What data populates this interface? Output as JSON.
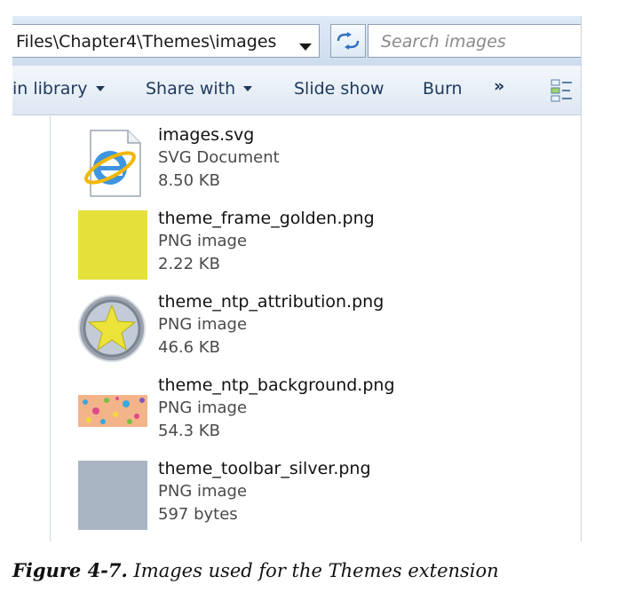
{
  "address": {
    "path": "Files\\Chapter4\\Themes\\images",
    "dropdown_icon": "chevron-down-icon",
    "refresh_icon": "refresh-arrows-icon"
  },
  "search": {
    "placeholder": "Search images",
    "icon": "search-icon"
  },
  "toolbar": {
    "include_label": "in library",
    "share_label": "Share with",
    "slideshow_label": "Slide show",
    "burn_label": "Burn",
    "overflow_label": "»",
    "views_icon": "change-view-icon"
  },
  "files": [
    {
      "name": "images.svg",
      "type": "SVG Document",
      "size": "8.50 KB",
      "icon": "ie-document-icon"
    },
    {
      "name": "theme_frame_golden.png",
      "type": "PNG image",
      "size": "2.22 KB",
      "icon": "yellow-thumbnail"
    },
    {
      "name": "theme_ntp_attribution.png",
      "type": "PNG image",
      "size": "46.6 KB",
      "icon": "star-badge-thumbnail"
    },
    {
      "name": "theme_ntp_background.png",
      "type": "PNG image",
      "size": "54.3 KB",
      "icon": "polka-dot-thumbnail"
    },
    {
      "name": "theme_toolbar_silver.png",
      "type": "PNG image",
      "size": "597 bytes",
      "icon": "silver-thumbnail"
    }
  ],
  "colors": {
    "toolbar_text": "#1e395b",
    "golden": "#e6e13a",
    "silver": "#a9b5c2",
    "dot_background": "#f3b48a"
  },
  "caption": {
    "label": "Figure 4-7.",
    "text": "Images used for the Themes extension"
  }
}
